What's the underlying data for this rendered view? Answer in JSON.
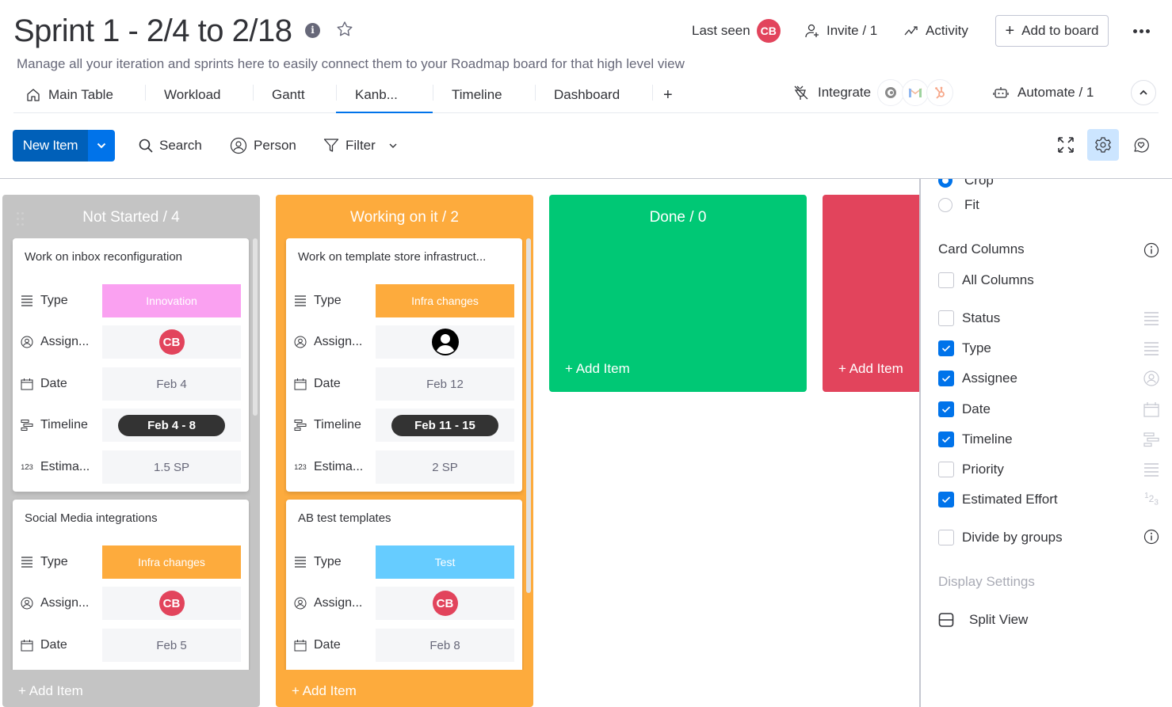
{
  "header": {
    "title": "Sprint 1 - 2/4 to 2/18",
    "description": "Manage all your iteration and sprints here to easily connect them to your Roadmap board for that high level view",
    "info_icon_glyph": "i",
    "last_seen_label": "Last seen",
    "last_seen_avatar": "CB",
    "invite_label": "Invite / 1",
    "activity_label": "Activity",
    "add_to_board_label": "Add to board",
    "add_to_board_plus": "+"
  },
  "tabs": [
    {
      "label": "Main Table",
      "icon": "home-icon"
    },
    {
      "label": "Workload"
    },
    {
      "label": "Gantt"
    },
    {
      "label": "Kanb...",
      "active": true
    },
    {
      "label": "Timeline"
    },
    {
      "label": "Dashboard"
    },
    {
      "label": "+"
    }
  ],
  "integrations": {
    "integrate_label": "Integrate",
    "apps": [
      "mailchimp",
      "gmail",
      "hubspot"
    ],
    "automate_label": "Automate / 1"
  },
  "toolbar": {
    "new_item_label": "New Item",
    "search_label": "Search",
    "person_label": "Person",
    "filter_label": "Filter"
  },
  "board": {
    "columns": [
      {
        "title": "Not Started / 4",
        "color": "#c4c4c4",
        "add_label": "+ Add Item",
        "cards": [
          {
            "title": "Work on inbox reconfiguration",
            "type": {
              "label": "Type",
              "value": "Innovation",
              "color": "#faa1f1"
            },
            "assignee": {
              "label": "Assign...",
              "value": "CB"
            },
            "date": {
              "label": "Date",
              "value": "Feb 4"
            },
            "timeline": {
              "label": "Timeline",
              "value": "Feb 4 - 8"
            },
            "estimate": {
              "label": "Estima...",
              "value": "1.5 SP"
            }
          },
          {
            "title": "Social Media integrations",
            "type": {
              "label": "Type",
              "value": "Infra changes",
              "color": "#fdab3d"
            },
            "assignee": {
              "label": "Assign...",
              "value": "CB"
            },
            "date": {
              "label": "Date",
              "value": "Feb 5"
            }
          }
        ]
      },
      {
        "title": "Working on it / 2",
        "color": "#fdab3d",
        "add_label": "+ Add Item",
        "cards": [
          {
            "title": "Work on template store infrastruct...",
            "type": {
              "label": "Type",
              "value": "Infra changes",
              "color": "#fdab3d"
            },
            "assignee": {
              "label": "Assign...",
              "value": ""
            },
            "date": {
              "label": "Date",
              "value": "Feb 12"
            },
            "timeline": {
              "label": "Timeline",
              "value": "Feb 11 - 15"
            },
            "estimate": {
              "label": "Estima...",
              "value": "2 SP"
            }
          },
          {
            "title": "AB test templates",
            "type": {
              "label": "Type",
              "value": "Test",
              "color": "#66ccff"
            },
            "assignee": {
              "label": "Assign...",
              "value": "CB"
            },
            "date": {
              "label": "Date",
              "value": "Feb 8"
            }
          }
        ]
      },
      {
        "title": "Done / 0",
        "color": "#00c875",
        "add_label": "+ Add Item"
      },
      {
        "title": "",
        "color": "#e2445c",
        "add_label": "+ Add Item"
      }
    ]
  },
  "settings_panel": {
    "image_options": [
      {
        "label": "Crop",
        "selected": true
      },
      {
        "label": "Fit",
        "selected": false
      }
    ],
    "card_columns_heading": "Card Columns",
    "all_columns_label": "All Columns",
    "columns": [
      {
        "label": "Status",
        "checked": false,
        "icon": "status-icon"
      },
      {
        "label": "Type",
        "checked": true,
        "icon": "status-icon"
      },
      {
        "label": "Assignee",
        "checked": true,
        "icon": "person-icon"
      },
      {
        "label": "Date",
        "checked": true,
        "icon": "calendar-icon"
      },
      {
        "label": "Timeline",
        "checked": true,
        "icon": "timeline-icon"
      },
      {
        "label": "Priority",
        "checked": false,
        "icon": "status-icon"
      },
      {
        "label": "Estimated Effort",
        "checked": true,
        "icon": "numbers-icon"
      }
    ],
    "divide_by_groups_label": "Divide by groups",
    "divide_by_groups_checked": false,
    "display_settings_label": "Display Settings",
    "split_view_label": "Split View"
  },
  "colors": {
    "primary": "#0073ea",
    "primary_dark": "#0060b9",
    "not_started": "#c4c4c4",
    "working": "#fdab3d",
    "done": "#00c875",
    "stuck": "#e2445c"
  }
}
